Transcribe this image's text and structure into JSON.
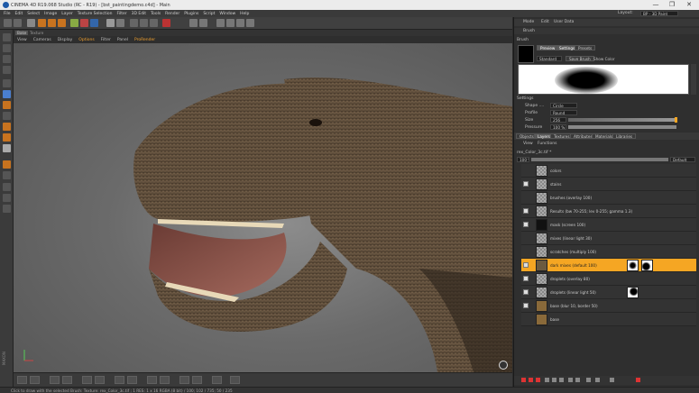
{
  "window": {
    "title": "CINEMA 4D R19.068 Studio (RC - R19) - [bst_paintingdemo.c4d] - Main",
    "minimize": "—",
    "maximize": "❐",
    "close": "✕"
  },
  "menu": [
    "File",
    "Edit",
    "Select",
    "Image",
    "Layer",
    "Texture Selection",
    "Filter",
    "3D Edit",
    "Tools",
    "Render",
    "Plugins",
    "Script",
    "Window",
    "Help"
  ],
  "viewport": {
    "tabs": [
      "Bake",
      "Texture"
    ],
    "menu": [
      "View",
      "Cameras",
      "Display",
      "Options",
      "Filter",
      "Panel",
      "ProRender"
    ],
    "active_menu": "Options"
  },
  "right_panel": {
    "top_tabs": [
      "Mode",
      "Edit",
      "User Data"
    ],
    "layout_label": "Layout:",
    "layout_value": "BP - 3D Paint",
    "section_brush": "Brush",
    "brush_title": "Brush",
    "brush_tabs": [
      "Preview",
      "Settings",
      "Presets"
    ],
    "brush_type": "Standard",
    "save_brush": "Save Brush",
    "show_color": "Show Color",
    "settings_title": "Settings",
    "settings": [
      {
        "label": "Shape ....",
        "value": "Circle"
      },
      {
        "label": "Profile",
        "value": "Round"
      },
      {
        "label": "Size",
        "value": "256"
      },
      {
        "label": "Pressure",
        "value": "100 %"
      }
    ],
    "lower_tabs": [
      "Objects",
      "Layers",
      "Textures",
      "Attributes",
      "Materials",
      "Libraries"
    ],
    "layer_menu": [
      "View",
      "Functions"
    ],
    "material_name": "rex_Color_3c.tif *",
    "opacity": "100 %",
    "blend_mode": "Default",
    "layers": [
      {
        "name": "colors"
      },
      {
        "name": "stains"
      },
      {
        "name": "brushes (overlay 100)"
      },
      {
        "name": "Results (bw 70-255; lev 0-255; gamma 1.3)"
      },
      {
        "name": "mask (screen 100)"
      },
      {
        "name": "mixes (linear light 30)"
      },
      {
        "name": "scratches (multiply 100)"
      },
      {
        "name": "dark mixes (default 100)",
        "selected": true,
        "has_mask": true
      },
      {
        "name": "droplets (overlay 80)"
      },
      {
        "name": "droplets (linear light 50)",
        "has_mask": true
      },
      {
        "name": "base (blur 10, border 50)"
      },
      {
        "name": "base"
      }
    ]
  },
  "status": {
    "text": "Click to draw with the selected Brush: Texture: rex_Color_3c.tif ; 1 RES: 1 x 16 RGBA (8 bit) / 100; 102 / 735; 50 / 235"
  },
  "side_label": "MAXON",
  "colors": {
    "accent": "#f5a623",
    "active_menu": "#f0a030",
    "titlebar": "#ececec",
    "panel_bg": "#2f2f2f"
  }
}
